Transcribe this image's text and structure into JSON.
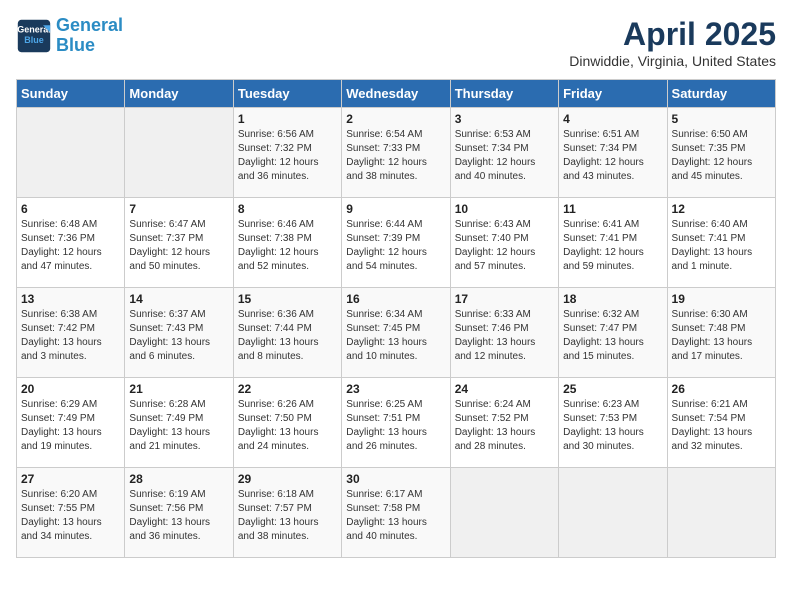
{
  "header": {
    "logo_line1": "General",
    "logo_line2": "Blue",
    "month_title": "April 2025",
    "location": "Dinwiddie, Virginia, United States"
  },
  "days_of_week": [
    "Sunday",
    "Monday",
    "Tuesday",
    "Wednesday",
    "Thursday",
    "Friday",
    "Saturday"
  ],
  "weeks": [
    [
      {
        "day": "",
        "info": ""
      },
      {
        "day": "",
        "info": ""
      },
      {
        "day": "1",
        "info": "Sunrise: 6:56 AM\nSunset: 7:32 PM\nDaylight: 12 hours and 36 minutes."
      },
      {
        "day": "2",
        "info": "Sunrise: 6:54 AM\nSunset: 7:33 PM\nDaylight: 12 hours and 38 minutes."
      },
      {
        "day": "3",
        "info": "Sunrise: 6:53 AM\nSunset: 7:34 PM\nDaylight: 12 hours and 40 minutes."
      },
      {
        "day": "4",
        "info": "Sunrise: 6:51 AM\nSunset: 7:34 PM\nDaylight: 12 hours and 43 minutes."
      },
      {
        "day": "5",
        "info": "Sunrise: 6:50 AM\nSunset: 7:35 PM\nDaylight: 12 hours and 45 minutes."
      }
    ],
    [
      {
        "day": "6",
        "info": "Sunrise: 6:48 AM\nSunset: 7:36 PM\nDaylight: 12 hours and 47 minutes."
      },
      {
        "day": "7",
        "info": "Sunrise: 6:47 AM\nSunset: 7:37 PM\nDaylight: 12 hours and 50 minutes."
      },
      {
        "day": "8",
        "info": "Sunrise: 6:46 AM\nSunset: 7:38 PM\nDaylight: 12 hours and 52 minutes."
      },
      {
        "day": "9",
        "info": "Sunrise: 6:44 AM\nSunset: 7:39 PM\nDaylight: 12 hours and 54 minutes."
      },
      {
        "day": "10",
        "info": "Sunrise: 6:43 AM\nSunset: 7:40 PM\nDaylight: 12 hours and 57 minutes."
      },
      {
        "day": "11",
        "info": "Sunrise: 6:41 AM\nSunset: 7:41 PM\nDaylight: 12 hours and 59 minutes."
      },
      {
        "day": "12",
        "info": "Sunrise: 6:40 AM\nSunset: 7:41 PM\nDaylight: 13 hours and 1 minute."
      }
    ],
    [
      {
        "day": "13",
        "info": "Sunrise: 6:38 AM\nSunset: 7:42 PM\nDaylight: 13 hours and 3 minutes."
      },
      {
        "day": "14",
        "info": "Sunrise: 6:37 AM\nSunset: 7:43 PM\nDaylight: 13 hours and 6 minutes."
      },
      {
        "day": "15",
        "info": "Sunrise: 6:36 AM\nSunset: 7:44 PM\nDaylight: 13 hours and 8 minutes."
      },
      {
        "day": "16",
        "info": "Sunrise: 6:34 AM\nSunset: 7:45 PM\nDaylight: 13 hours and 10 minutes."
      },
      {
        "day": "17",
        "info": "Sunrise: 6:33 AM\nSunset: 7:46 PM\nDaylight: 13 hours and 12 minutes."
      },
      {
        "day": "18",
        "info": "Sunrise: 6:32 AM\nSunset: 7:47 PM\nDaylight: 13 hours and 15 minutes."
      },
      {
        "day": "19",
        "info": "Sunrise: 6:30 AM\nSunset: 7:48 PM\nDaylight: 13 hours and 17 minutes."
      }
    ],
    [
      {
        "day": "20",
        "info": "Sunrise: 6:29 AM\nSunset: 7:49 PM\nDaylight: 13 hours and 19 minutes."
      },
      {
        "day": "21",
        "info": "Sunrise: 6:28 AM\nSunset: 7:49 PM\nDaylight: 13 hours and 21 minutes."
      },
      {
        "day": "22",
        "info": "Sunrise: 6:26 AM\nSunset: 7:50 PM\nDaylight: 13 hours and 24 minutes."
      },
      {
        "day": "23",
        "info": "Sunrise: 6:25 AM\nSunset: 7:51 PM\nDaylight: 13 hours and 26 minutes."
      },
      {
        "day": "24",
        "info": "Sunrise: 6:24 AM\nSunset: 7:52 PM\nDaylight: 13 hours and 28 minutes."
      },
      {
        "day": "25",
        "info": "Sunrise: 6:23 AM\nSunset: 7:53 PM\nDaylight: 13 hours and 30 minutes."
      },
      {
        "day": "26",
        "info": "Sunrise: 6:21 AM\nSunset: 7:54 PM\nDaylight: 13 hours and 32 minutes."
      }
    ],
    [
      {
        "day": "27",
        "info": "Sunrise: 6:20 AM\nSunset: 7:55 PM\nDaylight: 13 hours and 34 minutes."
      },
      {
        "day": "28",
        "info": "Sunrise: 6:19 AM\nSunset: 7:56 PM\nDaylight: 13 hours and 36 minutes."
      },
      {
        "day": "29",
        "info": "Sunrise: 6:18 AM\nSunset: 7:57 PM\nDaylight: 13 hours and 38 minutes."
      },
      {
        "day": "30",
        "info": "Sunrise: 6:17 AM\nSunset: 7:58 PM\nDaylight: 13 hours and 40 minutes."
      },
      {
        "day": "",
        "info": ""
      },
      {
        "day": "",
        "info": ""
      },
      {
        "day": "",
        "info": ""
      }
    ]
  ]
}
